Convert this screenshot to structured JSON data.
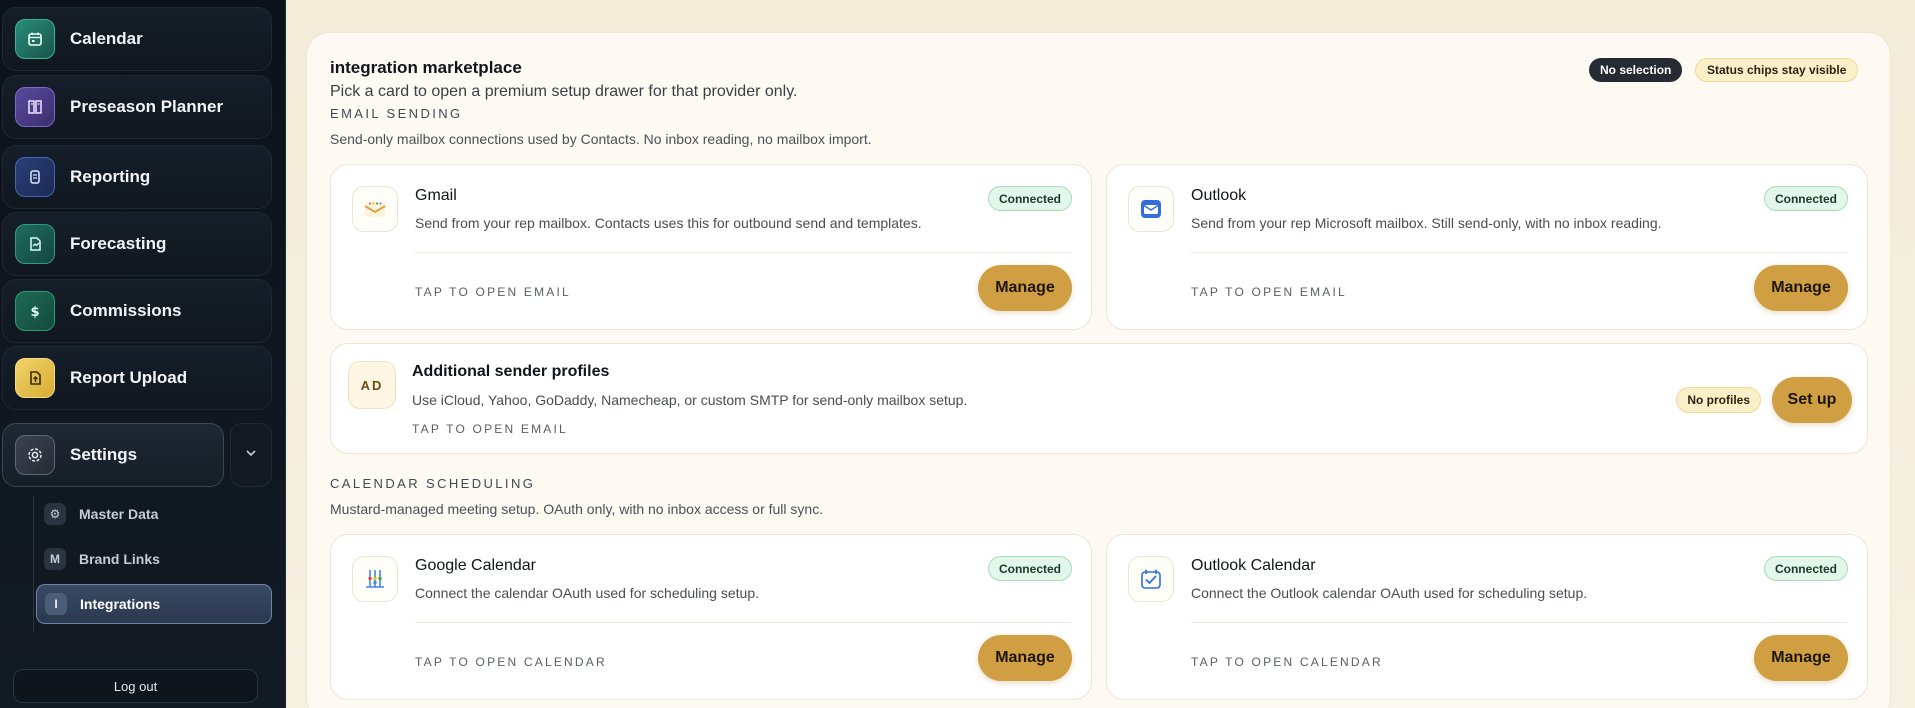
{
  "sidebar": {
    "items": [
      {
        "label": "Calendar",
        "icon": "calendar-icon"
      },
      {
        "label": "Preseason Planner",
        "icon": "book-icon"
      },
      {
        "label": "Reporting",
        "icon": "document-icon"
      },
      {
        "label": "Forecasting",
        "icon": "forecast-icon"
      },
      {
        "label": "Commissions",
        "icon": "dollar-icon"
      },
      {
        "label": "Report Upload",
        "icon": "upload-icon"
      }
    ],
    "settings": {
      "label": "Settings",
      "icon": "gear-icon"
    },
    "sub_items": [
      {
        "label": "Master Data",
        "glyph": "⚙",
        "active": false
      },
      {
        "label": "Brand Links",
        "glyph": "M",
        "active": false
      },
      {
        "label": "Integrations",
        "glyph": "I",
        "active": true
      }
    ],
    "logout_label": "Log out"
  },
  "main": {
    "title": "integration marketplace",
    "subtitle": "Pick a card to open a premium setup drawer for that provider only.",
    "chips": {
      "selection": "No selection",
      "status": "Status chips stay visible"
    },
    "email": {
      "heading": "EMAIL SENDING",
      "description": "Send-only mailbox connections used by Contacts. No inbox reading, no mailbox import.",
      "cards": [
        {
          "title": "Gmail",
          "desc": "Send from your rep mailbox. Contacts uses this for outbound send and templates.",
          "badge": "Connected",
          "tap": "TAP TO OPEN  EMAIL",
          "button": "Manage",
          "logo": "gmail-logo-icon"
        },
        {
          "title": "Outlook",
          "desc": "Send from your rep Microsoft mailbox. Still send-only, with no inbox reading.",
          "badge": "Connected",
          "tap": "TAP TO OPEN  EMAIL",
          "button": "Manage",
          "logo": "outlook-logo-icon"
        }
      ],
      "extra": {
        "logo_text": "AD",
        "title": "Additional sender profiles",
        "desc": "Use iCloud, Yahoo, GoDaddy, Namecheap, or custom SMTP for send-only mailbox setup.",
        "tap": "TAP TO OPEN  EMAIL",
        "badge": "No profiles",
        "button": "Set up"
      }
    },
    "calendar": {
      "heading": "CALENDAR SCHEDULING",
      "description": "Mustard-managed meeting setup. OAuth only, with no inbox access or full sync.",
      "cards": [
        {
          "title": "Google Calendar",
          "desc": "Connect the calendar OAuth used for scheduling setup.",
          "badge": "Connected",
          "tap": "TAP TO OPEN  CALENDAR",
          "button": "Manage",
          "logo": "google-calendar-logo-icon"
        },
        {
          "title": "Outlook Calendar",
          "desc": "Connect the Outlook calendar OAuth used for scheduling setup.",
          "badge": "Connected",
          "tap": "TAP TO OPEN  CALENDAR",
          "button": "Manage",
          "logo": "outlook-calendar-logo-icon"
        }
      ]
    }
  },
  "colors": {
    "accent": "#d19f43",
    "connected_bg": "#e3f6ea",
    "sidebar_bg": "#0c1219"
  }
}
